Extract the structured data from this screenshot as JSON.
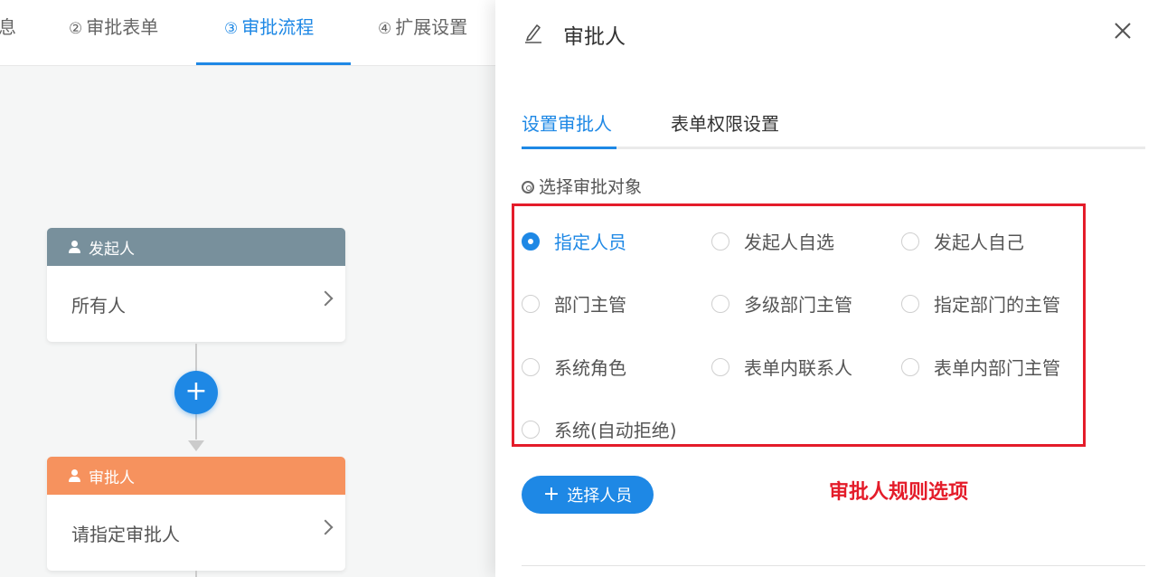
{
  "steps": [
    {
      "num": "",
      "label": "息"
    },
    {
      "num": "②",
      "label": "审批表单"
    },
    {
      "num": "③",
      "label": "审批流程"
    },
    {
      "num": "④",
      "label": "扩展设置"
    }
  ],
  "flow": {
    "start_node": {
      "title": "发起人",
      "body": "所有人"
    },
    "approve_node": {
      "title": "审批人",
      "body": "请指定审批人"
    },
    "add_button": "+"
  },
  "panel": {
    "title": "审批人",
    "tabs": [
      "设置审批人",
      "表单权限设置"
    ],
    "section_label": "选择审批对象",
    "options": [
      {
        "label": "指定人员",
        "checked": true
      },
      {
        "label": "发起人自选",
        "checked": false
      },
      {
        "label": "发起人自己",
        "checked": false
      },
      {
        "label": "部门主管",
        "checked": false
      },
      {
        "label": "多级部门主管",
        "checked": false
      },
      {
        "label": "指定部门的主管",
        "checked": false
      },
      {
        "label": "系统角色",
        "checked": false
      },
      {
        "label": "表单内联系人",
        "checked": false
      },
      {
        "label": "表单内部门主管",
        "checked": false
      },
      {
        "label": "系统(自动拒绝)",
        "checked": false
      }
    ],
    "select_button": "选择人员",
    "annotation": "审批人规则选项"
  },
  "colors": {
    "accent": "#1e88e5",
    "start_header": "#78909c",
    "approve_header": "#f6925e",
    "annotation_red": "#e41c2a"
  }
}
